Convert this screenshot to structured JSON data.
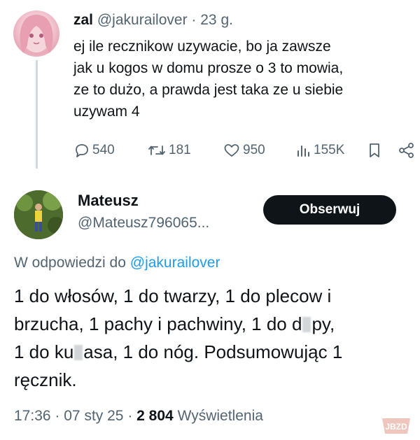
{
  "tweet": {
    "author_name": "zal",
    "author_handle": "@jakurailover",
    "separator": "·",
    "time": "23 g.",
    "text_lines": [
      "ej ile recznikow uzywacie, bo ja zawsze",
      "jak u kogos w domu prosze o 3 to mowia,",
      "ze to dużo, a prawda jest taka ze u siebie",
      "uzywam 4"
    ],
    "replies": "540",
    "reposts": "181",
    "likes": "950",
    "views": "155K",
    "icons": [
      "reply-icon",
      "repost-icon",
      "like-icon",
      "views-icon",
      "bookmark-icon",
      "share-icon"
    ]
  },
  "reply": {
    "author_name": "Mateusz",
    "author_handle": "@Mateusz796065...",
    "follow_label": "Obserwuj",
    "reply_to_prefix": "W odpowiedzi do",
    "reply_to_handle": "@jakurailover",
    "line1": "1 do włosów, 1 do twarzy, 1 do plecow i",
    "line2": "brzucha, 1 pachy i pachwiny, 1 do d",
    "line2_end": "py,",
    "line3_start": "1 do ku",
    "line3_end": "asa, 1 do nóg. Podsumowując 1",
    "line4": "ręcznik.",
    "time": "17:36",
    "date": "07 sty 25",
    "sep": "·",
    "views_count": "2 804",
    "views_label": "Wyświetlenia"
  },
  "watermark": {
    "text": "JBZD"
  },
  "colors": {
    "text": "#0f1419",
    "muted": "#536471",
    "link": "#1d9bf0",
    "button": "#0f1419"
  }
}
